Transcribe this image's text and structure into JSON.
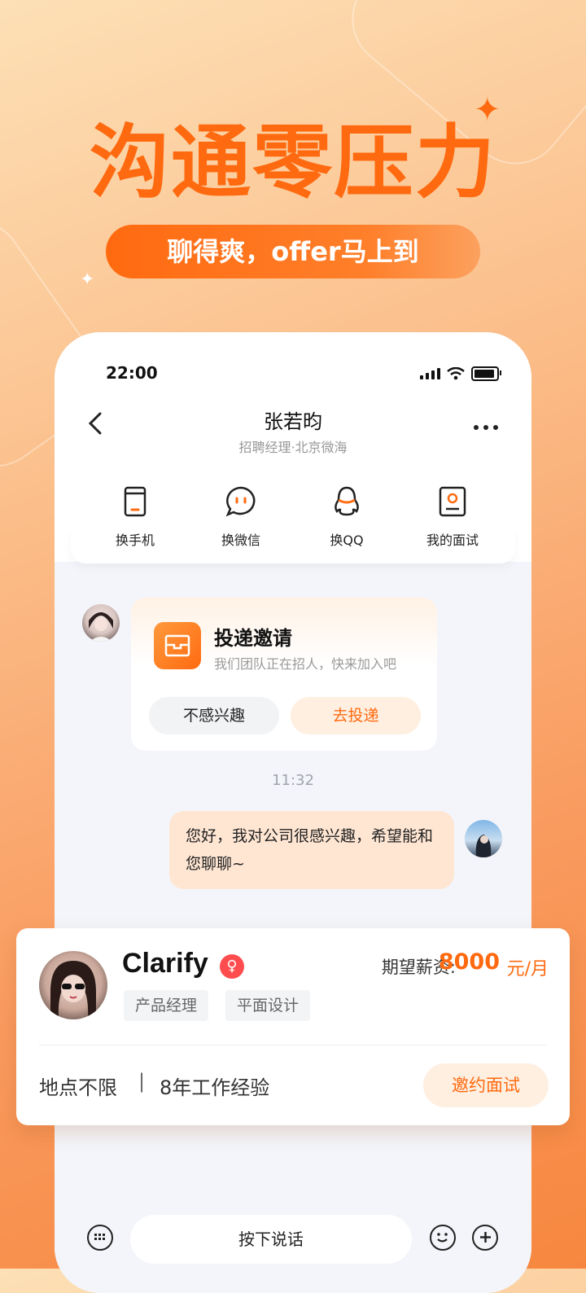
{
  "promo": {
    "headline": "沟通零压力",
    "tagline": "聊得爽，offer马上到"
  },
  "status_bar": {
    "time": "22:00"
  },
  "chat_header": {
    "back_icon": "chevron-left-icon",
    "name": "张若昀",
    "subtitle": "招聘经理·北京微海",
    "more_icon": "more-dots-icon"
  },
  "quick_actions": [
    {
      "label": "换手机",
      "icon": "phone-icon"
    },
    {
      "label": "换微信",
      "icon": "wechat-icon"
    },
    {
      "label": "换QQ",
      "icon": "qq-icon"
    },
    {
      "label": "我的面试",
      "icon": "interview-icon"
    }
  ],
  "invite_card": {
    "title": "投递邀请",
    "subtitle": "我们团队正在招人，快来加入吧",
    "decline_label": "不感兴趣",
    "accept_label": "去投递"
  },
  "timestamp": "11:32",
  "message": {
    "text": "您好，我对公司很感兴趣，希望能和您聊聊~"
  },
  "input_bar": {
    "hold_label": "按下说话"
  },
  "candidate": {
    "name": "Clarify",
    "tags": [
      "产品经理",
      "平面设计"
    ],
    "salary_label": "期望薪资:",
    "salary_value": "8000",
    "salary_unit": "元/月",
    "location": "地点不限",
    "separator": "|",
    "experience": "8年工作经验",
    "invite_label": "邀约面试"
  },
  "colors": {
    "accent": "#ff6a10",
    "accent_light": "#ffefe1",
    "bubble": "#ffe6d3"
  }
}
